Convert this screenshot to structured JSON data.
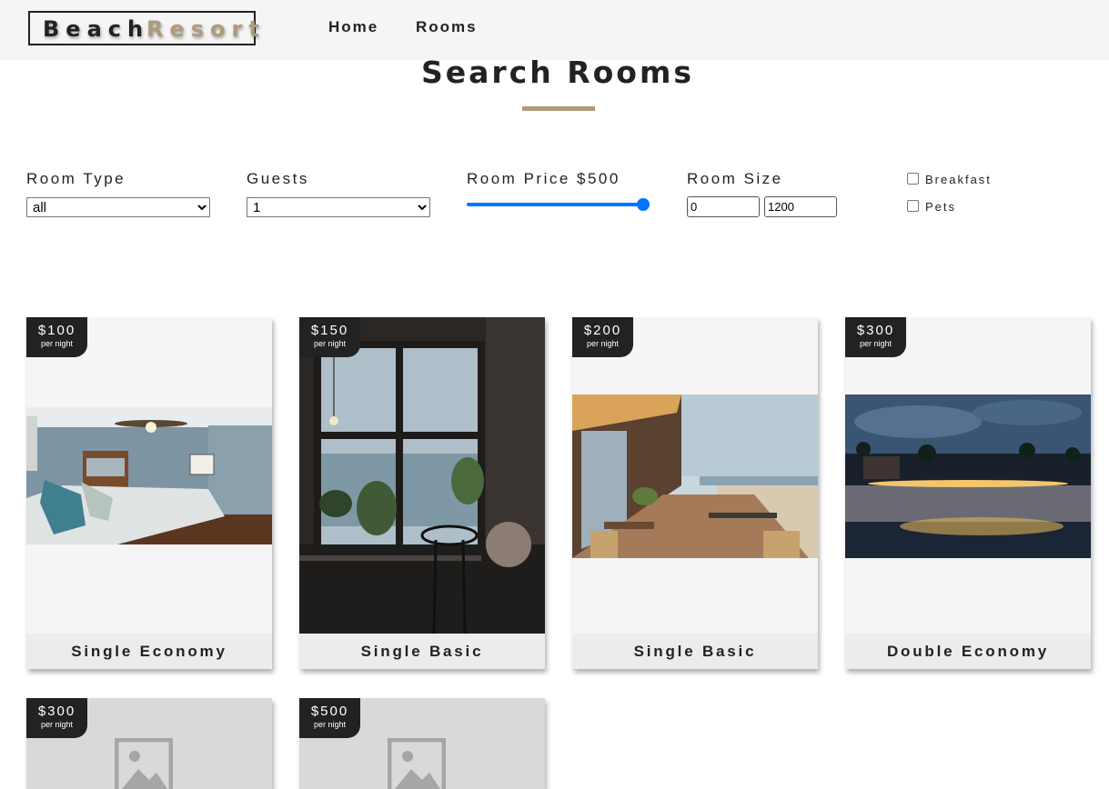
{
  "navbar": {
    "logo_part1": "Beach",
    "logo_part2": "Resort",
    "links": [
      "Home",
      "Rooms"
    ]
  },
  "page_title": "Search Rooms",
  "filters": {
    "room_type": {
      "label": "Room Type",
      "value": "all"
    },
    "guests": {
      "label": "Guests",
      "value": "1"
    },
    "room_price": {
      "label": "Room Price $500",
      "value": 500,
      "min": 0,
      "max": 500
    },
    "room_size": {
      "label": "Room Size",
      "min": "0",
      "max": "1200"
    },
    "breakfast": {
      "label": "Breakfast",
      "checked": false
    },
    "pets": {
      "label": "Pets",
      "checked": false
    }
  },
  "per_night_label": "per night",
  "rooms": [
    {
      "price": "$100",
      "name": "Single Economy",
      "image": "bedroom-photo"
    },
    {
      "price": "$150",
      "name": "Single Basic",
      "image": "window-cafe-photo"
    },
    {
      "price": "$200",
      "name": "Single Basic",
      "image": "beach-terrace-photo"
    },
    {
      "price": "$300",
      "name": "Double Economy",
      "image": "night-beach-photo"
    },
    {
      "price": "$300",
      "name": "",
      "image": "placeholder-image-icon"
    },
    {
      "price": "$500",
      "name": "",
      "image": "placeholder-image-icon"
    }
  ],
  "colors": {
    "accent": "#af9a7d",
    "navbar_bg": "#f5f5f5",
    "badge_bg": "#222222",
    "slider": "#0075ff",
    "placeholder_bg": "#d9d9d9"
  }
}
